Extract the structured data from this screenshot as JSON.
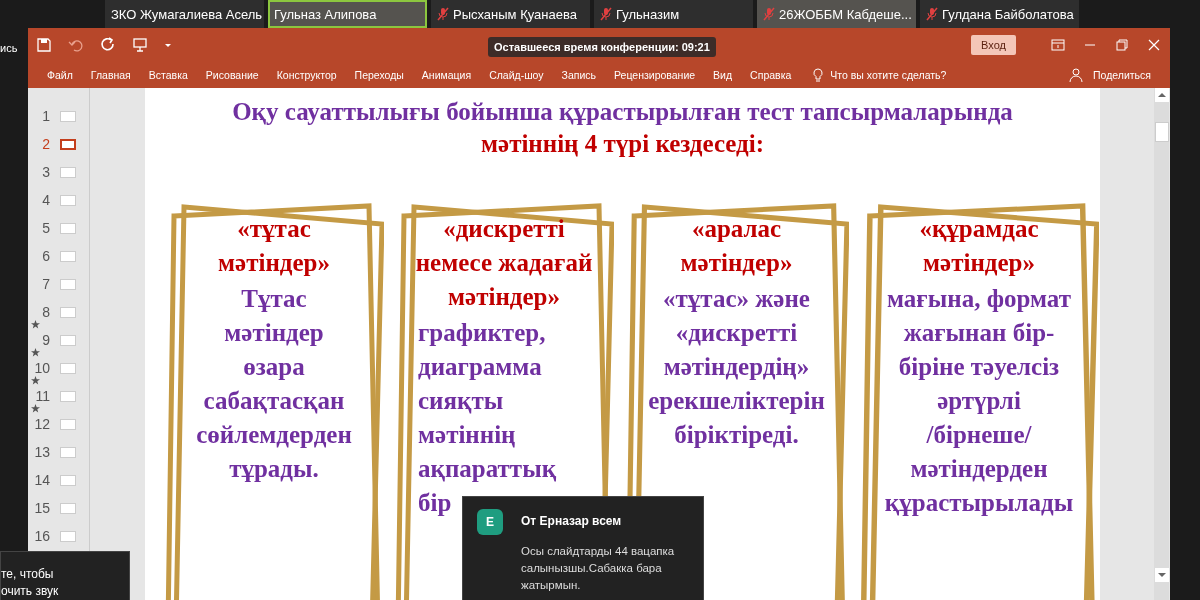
{
  "participants": [
    {
      "name": "ЗКО Жумагалиева Асель",
      "muted": false,
      "speaking": false,
      "video": false
    },
    {
      "name": "Гульназ Алипова",
      "muted": false,
      "speaking": true,
      "video": true
    },
    {
      "name": "Рысханым Қуанаева",
      "muted": true,
      "speaking": false,
      "video": false
    },
    {
      "name": "Гульназим",
      "muted": true,
      "speaking": false,
      "video": false
    },
    {
      "name": "26ЖОББМ Кабдеше...",
      "muted": true,
      "speaking": false,
      "video": true
    },
    {
      "name": "Гулдана Байболатова",
      "muted": true,
      "speaking": false,
      "video": false
    }
  ],
  "left_edge_text": "ись",
  "window": {
    "timer": "Оставшееся время конференции: 09:21",
    "sign_in": "Вход",
    "tabs": [
      "Файл",
      "Главная",
      "Вставка",
      "Рисование",
      "Конструктор",
      "Переходы",
      "Анимация",
      "Слайд-шоу",
      "Запись",
      "Рецензирование",
      "Вид",
      "Справка"
    ],
    "tell_me": "Что вы хотите сделать?",
    "share": "Поделиться"
  },
  "slides": [
    {
      "number": "1",
      "selected": false,
      "animated": false
    },
    {
      "number": "2",
      "selected": true,
      "animated": false
    },
    {
      "number": "3",
      "selected": false,
      "animated": false
    },
    {
      "number": "4",
      "selected": false,
      "animated": false
    },
    {
      "number": "5",
      "selected": false,
      "animated": false
    },
    {
      "number": "6",
      "selected": false,
      "animated": false
    },
    {
      "number": "7",
      "selected": false,
      "animated": false
    },
    {
      "number": "8",
      "selected": false,
      "animated": false
    },
    {
      "number": "9",
      "selected": false,
      "animated": true
    },
    {
      "number": "10",
      "selected": false,
      "animated": true
    },
    {
      "number": "11",
      "selected": false,
      "animated": true
    },
    {
      "number": "12",
      "selected": false,
      "animated": true
    },
    {
      "number": "13",
      "selected": false,
      "animated": false
    },
    {
      "number": "14",
      "selected": false,
      "animated": false
    },
    {
      "number": "15",
      "selected": false,
      "animated": false
    },
    {
      "number": "16",
      "selected": false,
      "animated": false
    }
  ],
  "slide": {
    "heading": "Оқу сауаттылығы бойынша құрастырылған тест тапсырмаларында",
    "heading_continued": "мәтіннің 4 түрі кездеседі:",
    "cards": [
      {
        "heading": "«тұтас\nмәтіндер»",
        "body": "Тұтас\nмәтіндер\nөзара\nсабақтасқан\nсөйлемдерден\nтұрады."
      },
      {
        "heading": "«дискретті\nнемесе жадағай\nмәтіндер»",
        "body": "графиктер,\nдиаграмма\nсияқты\nмәтіннің\nақпараттық\nбір"
      },
      {
        "heading": "«аралас\nмәтіндер»",
        "body": "«тұтас» және\n«дискретті\nмәтіндердің»\nерекшеліктерін\nбіріктіреді."
      },
      {
        "heading": "«құрамдас\nмәтіндер»",
        "body": "мағына, формат\nжағынан бір-\nбіріне тәуелсіз\nәртүрлі\n/бірнеше/\nмәтіндерден\nқұрастырылады"
      }
    ]
  },
  "chat_popup": {
    "avatar": "E",
    "sender": "От Ерназар всем",
    "message": "Осы слайдтарды 44 вацапка салынызшы.Сабакка бара жатырмын."
  },
  "audio_popup": {
    "lines": [
      "те, чтобы",
      "очить звук"
    ]
  }
}
